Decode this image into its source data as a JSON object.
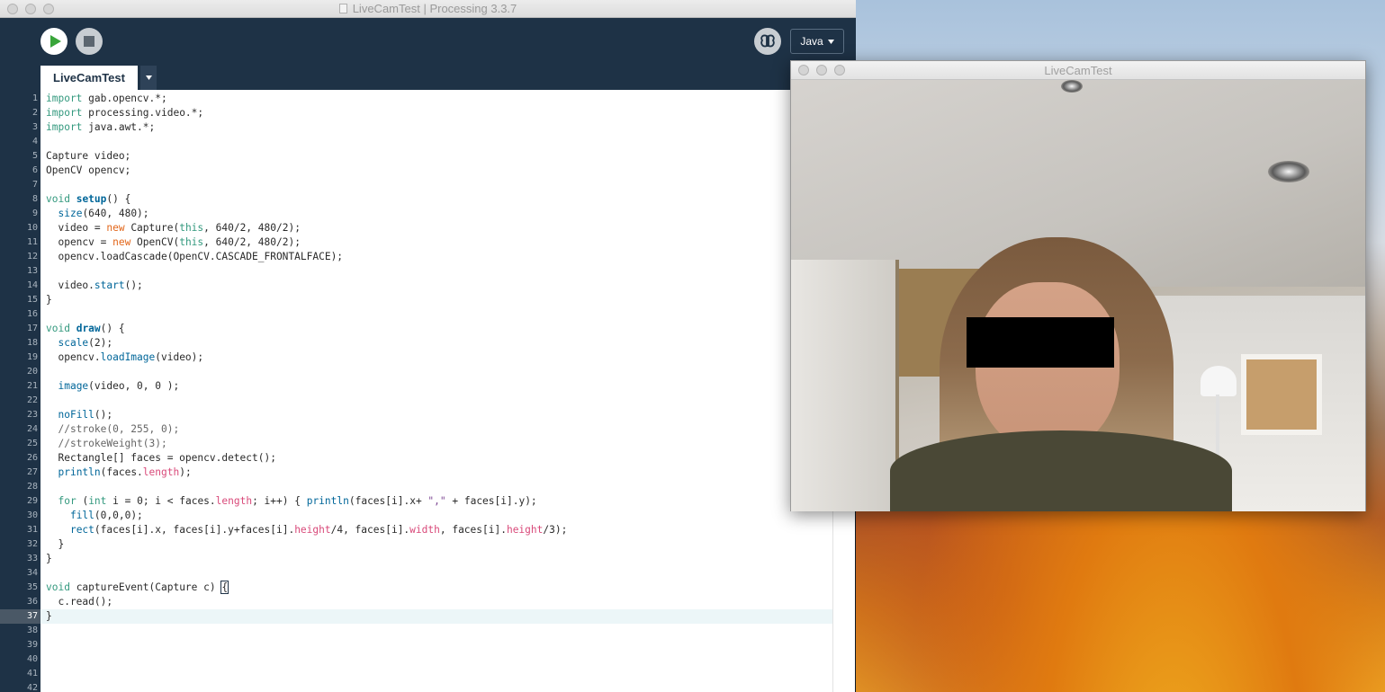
{
  "ide": {
    "window_title": "LiveCamTest | Processing 3.3.7",
    "mode_label": "Java",
    "tab_label": "LiveCamTest",
    "current_line": 37
  },
  "code_lines": [
    [
      [
        "k1",
        "import"
      ],
      [
        "p",
        " gab.opencv.*;"
      ]
    ],
    [
      [
        "k1",
        "import"
      ],
      [
        "p",
        " processing.video.*;"
      ]
    ],
    [
      [
        "k1",
        "import"
      ],
      [
        "p",
        " java.awt.*;"
      ]
    ],
    [],
    [
      [
        "p",
        "Capture video;"
      ]
    ],
    [
      [
        "p",
        "OpenCV opencv;"
      ]
    ],
    [],
    [
      [
        "k1",
        "void"
      ],
      [
        "p",
        " "
      ],
      [
        "fnb",
        "setup"
      ],
      [
        "p",
        "() {"
      ]
    ],
    [
      [
        "p",
        "  "
      ],
      [
        "fn",
        "size"
      ],
      [
        "p",
        "(640, 480);"
      ]
    ],
    [
      [
        "p",
        "  video = "
      ],
      [
        "k2",
        "new"
      ],
      [
        "p",
        " Capture("
      ],
      [
        "k1",
        "this"
      ],
      [
        "p",
        ", 640/2, 480/2);"
      ]
    ],
    [
      [
        "p",
        "  opencv = "
      ],
      [
        "k2",
        "new"
      ],
      [
        "p",
        " OpenCV("
      ],
      [
        "k1",
        "this"
      ],
      [
        "p",
        ", 640/2, 480/2);"
      ]
    ],
    [
      [
        "p",
        "  opencv.loadCascade(OpenCV.CASCADE_FRONTALFACE);"
      ]
    ],
    [],
    [
      [
        "p",
        "  video."
      ],
      [
        "fn",
        "start"
      ],
      [
        "p",
        "();"
      ]
    ],
    [
      [
        "p",
        "}"
      ]
    ],
    [],
    [
      [
        "k1",
        "void"
      ],
      [
        "p",
        " "
      ],
      [
        "fnb",
        "draw"
      ],
      [
        "p",
        "() {"
      ]
    ],
    [
      [
        "p",
        "  "
      ],
      [
        "fn",
        "scale"
      ],
      [
        "p",
        "(2);"
      ]
    ],
    [
      [
        "p",
        "  opencv."
      ],
      [
        "fn",
        "loadImage"
      ],
      [
        "p",
        "(video);"
      ]
    ],
    [],
    [
      [
        "p",
        "  "
      ],
      [
        "fn",
        "image"
      ],
      [
        "p",
        "(video, 0, 0 );"
      ]
    ],
    [],
    [
      [
        "p",
        "  "
      ],
      [
        "fn",
        "noFill"
      ],
      [
        "p",
        "();"
      ]
    ],
    [
      [
        "cm",
        "  //stroke(0, 255, 0);"
      ]
    ],
    [
      [
        "cm",
        "  //strokeWeight(3);"
      ]
    ],
    [
      [
        "p",
        "  Rectangle[] faces = opencv.detect();"
      ]
    ],
    [
      [
        "p",
        "  "
      ],
      [
        "fn",
        "println"
      ],
      [
        "p",
        "(faces."
      ],
      [
        "var",
        "length"
      ],
      [
        "p",
        ");"
      ]
    ],
    [],
    [
      [
        "p",
        "  "
      ],
      [
        "k1",
        "for"
      ],
      [
        "p",
        " ("
      ],
      [
        "k1",
        "int"
      ],
      [
        "p",
        " i = 0; i < faces."
      ],
      [
        "var",
        "length"
      ],
      [
        "p",
        "; i++) { "
      ],
      [
        "fn",
        "println"
      ],
      [
        "p",
        "(faces[i].x+ "
      ],
      [
        "str",
        "\",\""
      ],
      [
        "p",
        " + faces[i].y);"
      ]
    ],
    [
      [
        "p",
        "    "
      ],
      [
        "fn",
        "fill"
      ],
      [
        "p",
        "(0,0,0);"
      ]
    ],
    [
      [
        "p",
        "    "
      ],
      [
        "fn",
        "rect"
      ],
      [
        "p",
        "(faces[i].x, faces[i].y+faces[i]."
      ],
      [
        "var",
        "height"
      ],
      [
        "p",
        "/4, faces[i]."
      ],
      [
        "var",
        "width"
      ],
      [
        "p",
        ", faces[i]."
      ],
      [
        "var",
        "height"
      ],
      [
        "p",
        "/3);"
      ]
    ],
    [
      [
        "p",
        "  }"
      ]
    ],
    [
      [
        "p",
        "}"
      ]
    ],
    [],
    [
      [
        "k1",
        "void"
      ],
      [
        "p",
        " captureEvent(Capture c) "
      ],
      [
        "cur",
        "{"
      ]
    ],
    [
      [
        "p",
        "  c.read();"
      ]
    ],
    [
      [
        "p",
        "}"
      ]
    ],
    [],
    [],
    [],
    [],
    []
  ],
  "sketch": {
    "window_title": "LiveCamTest"
  },
  "icons": {
    "run": "play-icon",
    "stop": "stop-icon",
    "debug": "debugger-butterfly-icon",
    "dropdown": "chevron-down-icon"
  },
  "colors": {
    "ide_background": "#1e3246",
    "run_triangle": "#39a53a"
  }
}
